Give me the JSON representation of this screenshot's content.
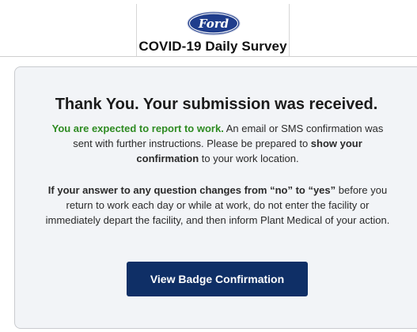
{
  "header": {
    "title": "COVID-19 Daily Survey",
    "logo_text": "Ford"
  },
  "card": {
    "heading": "Thank You. Your submission was received.",
    "para1": {
      "green_text": "You are expected to report to work.",
      "text_a": " An email or SMS confirmation was sent with further instructions. Please be prepared to ",
      "bold_text": "show your confirmation",
      "text_b": " to your work location."
    },
    "para2": {
      "bold_text": "If your answer to any question changes from “no” to “yes”",
      "text": " before you return to work each day or while at work, do not enter the facility or immediately depart the facility, and then inform Plant Medical of your action."
    },
    "button_label": "View Badge Confirmation"
  },
  "colors": {
    "brand_blue": "#0f2f66",
    "success_green": "#2e8b22",
    "card_background": "#f2f4f7"
  }
}
